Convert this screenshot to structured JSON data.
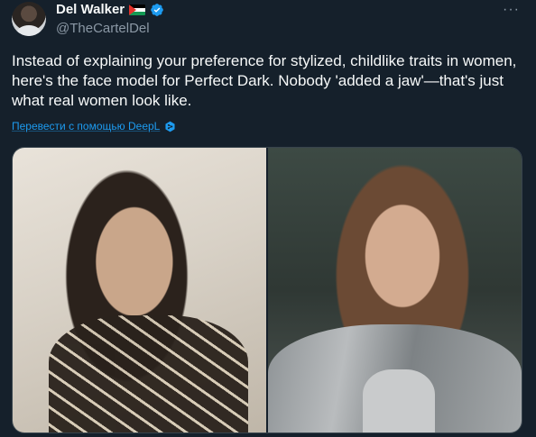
{
  "tweet": {
    "author_name": "Del Walker",
    "author_handle": "@TheCartelDel",
    "more_icon": "···",
    "text": "Instead of explaining your preference for stylized, childlike traits in women, here's the face model for Perfect Dark. Nobody 'added a jaw'—that's just what real women look like.",
    "translate_label": "Перевести с помощью DeepL",
    "media_count": 2
  },
  "colors": {
    "background": "#15202b",
    "text": "#f7f9f9",
    "secondary_text": "#8b98a5",
    "accent": "#1d9bf0",
    "verified": "#1d9bf0"
  },
  "icons": {
    "flag": "palestine-flag-icon",
    "verified": "verified-badge-icon",
    "translate": "deepl-icon"
  }
}
